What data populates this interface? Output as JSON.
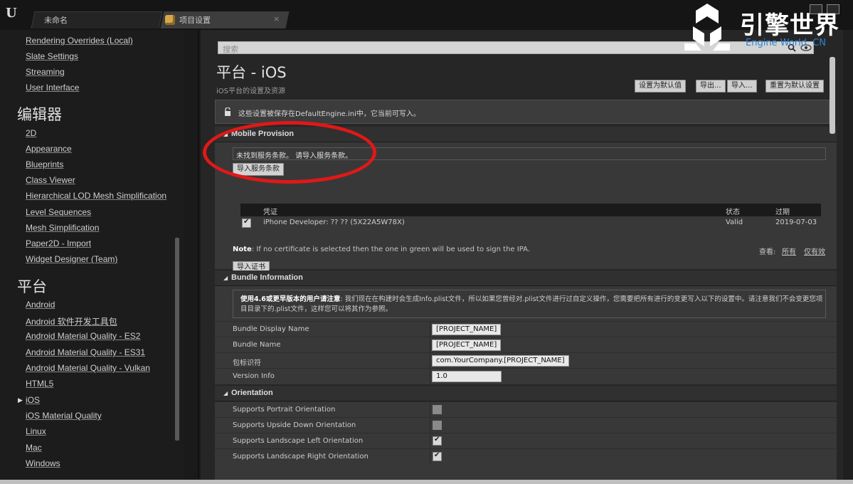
{
  "window": {
    "tabs": [
      {
        "label": "未命名"
      },
      {
        "label": "项目设置"
      }
    ],
    "close_glyph": "×"
  },
  "watermark": {
    "title": "引擎世界",
    "subtitle": "Engine World. CN"
  },
  "sidebar": {
    "top_items": [
      "Rendering Overrides (Local)",
      "Slate Settings",
      "Streaming",
      "User Interface"
    ],
    "editor_header": "编辑器",
    "editor_items": [
      "2D",
      "Appearance",
      "Blueprints",
      "Class Viewer",
      "Hierarchical LOD Mesh Simplification",
      "Level Sequences",
      "Mesh Simplification",
      "Paper2D - Import",
      "Widget Designer (Team)"
    ],
    "platform_header": "平台",
    "platform_items": [
      "Android",
      "Android 软件开发工具包",
      "Android Material Quality - ES2",
      "Android Material Quality - ES31",
      "Android Material Quality - Vulkan",
      "HTML5",
      "iOS",
      "iOS Material Quality",
      "Linux",
      "Mac",
      "Windows"
    ],
    "selected": "iOS"
  },
  "main": {
    "search_placeholder": "搜索",
    "title": "平台 - iOS",
    "subtitle": "iOS平台的设置及资源",
    "buttons": [
      "设置为默认值",
      "导出...",
      "导入...",
      "重置为默认设置"
    ],
    "notice": "这些设置被保存在DefaultEngine.ini中，它当前可写入。"
  },
  "mobile_provision": {
    "header": "Mobile Provision",
    "error": "未找到服务条款。 请导入服务条款。",
    "import_button": "导入服务条款",
    "cert_columns": [
      "凭证",
      "状态",
      "过期"
    ],
    "cert_rows": [
      {
        "name": "iPhone Developer: ?? ?? (5X22A5W78X)",
        "status": "Valid",
        "expires": "2019-07-03",
        "checked": true
      }
    ],
    "note_label": "Note",
    "note_text": ": If no certificate is selected then the one in green will be used to sign the IPA.",
    "view_label": "查看:",
    "view_all": "所有",
    "view_valid": "仅有效",
    "import_cert_button": "导入证书"
  },
  "bundle": {
    "header": "Bundle Information",
    "warning_bold": "使用4.6或更早版本的用户请注意",
    "warning_text1": ": 我们现在在构建时会生成Info.plist文件，所以如果您曾经对.plist文件进行过自定义操作，您需要把所有进行的变更写入以下的设置中。请注意我们不会变更您项目目录下的.plist文件，这样您可以将其作为参照。",
    "rows": [
      {
        "key": "Bundle Display Name",
        "value": "[PROJECT_NAME]"
      },
      {
        "key": "Bundle Name",
        "value": "[PROJECT_NAME]"
      },
      {
        "key": "包标识符",
        "value": "com.YourCompany.[PROJECT_NAME]"
      },
      {
        "key": "Version Info",
        "value": "1.0"
      }
    ]
  },
  "orientation": {
    "header": "Orientation",
    "rows": [
      {
        "key": "Supports Portrait Orientation",
        "checked": false
      },
      {
        "key": "Supports Upside Down Orientation",
        "checked": false
      },
      {
        "key": "Supports Landscape Left Orientation",
        "checked": true
      },
      {
        "key": "Supports Landscape Right Orientation",
        "checked": true
      }
    ]
  }
}
